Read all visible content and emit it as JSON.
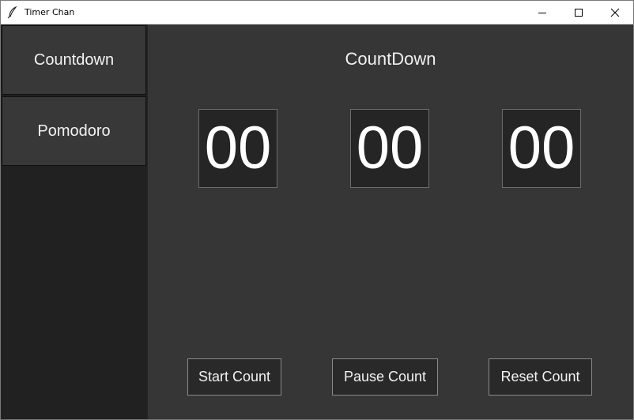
{
  "window": {
    "title": "Timer Chan",
    "app_icon": "feather-icon",
    "controls": [
      "minimize-icon",
      "maximize-icon",
      "close-icon"
    ]
  },
  "sidebar": {
    "items": [
      {
        "label": "Countdown"
      },
      {
        "label": "Pomodoro"
      }
    ]
  },
  "main": {
    "heading": "CountDown",
    "timer": {
      "hours": "00",
      "minutes": "00",
      "seconds": "00"
    },
    "buttons": {
      "start": "Start Count",
      "pause": "Pause Count",
      "reset": "Reset Count"
    }
  },
  "colors": {
    "sidebar_bg": "#212121",
    "nav_button_bg": "#383838",
    "main_bg": "#363636",
    "digit_bg": "#252525",
    "button_bg": "#292929",
    "text": "#f2f2f2"
  }
}
